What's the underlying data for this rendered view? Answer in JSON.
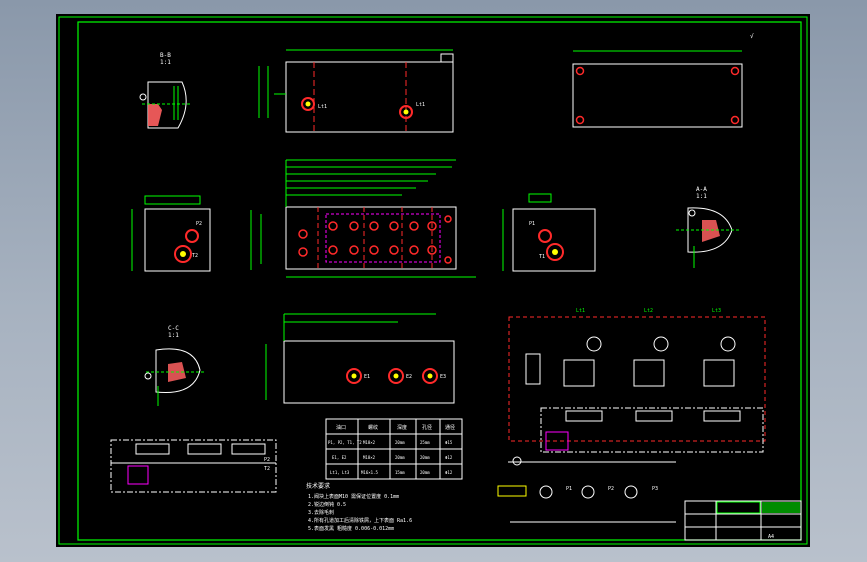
{
  "views": {
    "section_b": {
      "title": "B-B",
      "scale": "1:1"
    },
    "section_a": {
      "title": "A-A",
      "scale": "1:1"
    },
    "section_c": {
      "title": "C-C",
      "scale": "1:1"
    }
  },
  "ports": {
    "top_view": [
      "Lt1",
      "Lt1"
    ],
    "left_view": [
      "P2",
      "T2"
    ],
    "right_view": [
      "P1",
      "T1"
    ],
    "bottom_view": [
      "E1",
      "E2",
      "E3"
    ],
    "schematic_bottom": [
      "P2",
      "T2"
    ]
  },
  "schematic": {
    "valve_labels": [
      "Lt1",
      "Lt2",
      "Lt3"
    ],
    "pump_labels": [
      "P1",
      "P2",
      "P3"
    ]
  },
  "port_table": {
    "headers": [
      "油口",
      "螺纹",
      "深度",
      "孔径",
      "通径"
    ],
    "rows": [
      [
        "P1, P2, T1, T2",
        "M18×2",
        "20mm",
        "25mm",
        "Φ15"
      ],
      [
        "E1, E2",
        "M18×2",
        "20mm",
        "20mm",
        "Φ12"
      ],
      [
        "Lt1, Lt3",
        "M16×1.5",
        "15mm",
        "20mm",
        "Φ12"
      ]
    ]
  },
  "notes": {
    "title": "技术要求",
    "lines": [
      "1.阀块上表面M10 需保证位置度 0.1mm",
      "2.锐边倒钝 0.5",
      "3.去除毛刺",
      "4.所有孔道加工后清除铁屑，上下表面 Ra1.6",
      "5.表面发黑  粗糙度 0.006-0.012mm"
    ]
  },
  "title_block": {
    "sheet_size": "A4"
  },
  "colors": {
    "frame": "#00ff00",
    "outline": "#ffffff",
    "dimension": "#00ff00",
    "hidden_line": "#ff00ff",
    "port_ring": "#ff2a2a",
    "centerline": "#ff2a2a",
    "accent": "#ffff00"
  }
}
